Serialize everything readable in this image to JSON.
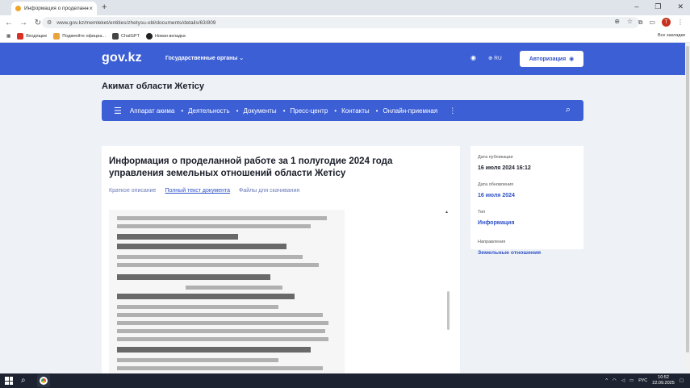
{
  "browser": {
    "tab_title": "Информация о проделанной",
    "url": "www.gov.kz/memleket/entities/zhetysu-obl/documents/details/63/809",
    "bookmarks": [
      "Входящие",
      "Подвеейте официа...",
      "ChatGPT",
      "Новая вкладка"
    ],
    "bookmarks_right": "Все закладки",
    "profile_initial": "T"
  },
  "header": {
    "logo": "gov.kz",
    "gov_menu": "Государственные органы",
    "lang": "RU",
    "auth_label": "Авторизация"
  },
  "org_title": "Акимат области Жетісу",
  "nav": {
    "items": [
      "Аппарат акима",
      "Деятельность",
      "Документы",
      "Пресс-центр",
      "Контакты",
      "Онлайн-приемная"
    ]
  },
  "doc": {
    "title": "Информация о проделанной работе за 1 полугодие 2024 года управления земельных отношений области Жетісу",
    "tabs": [
      "Краткое описание",
      "Полный текст документа",
      "Файлы для скачивания"
    ],
    "active_tab": 1
  },
  "meta": {
    "pub_label": "Дата публикации",
    "pub_value": "16 июля 2024 16:12",
    "upd_label": "Дата обновления",
    "upd_value": "16 июля 2024",
    "type_label": "Тип",
    "type_value": "Информация",
    "dir_label": "Направления",
    "dir_value": "Земельные отношения"
  },
  "taskbar": {
    "lang": "РУС",
    "time": "10:52",
    "date": "22.09.2025"
  },
  "colors": {
    "brand_blue": "#3c5fd6",
    "link_blue": "#2f52c7"
  }
}
